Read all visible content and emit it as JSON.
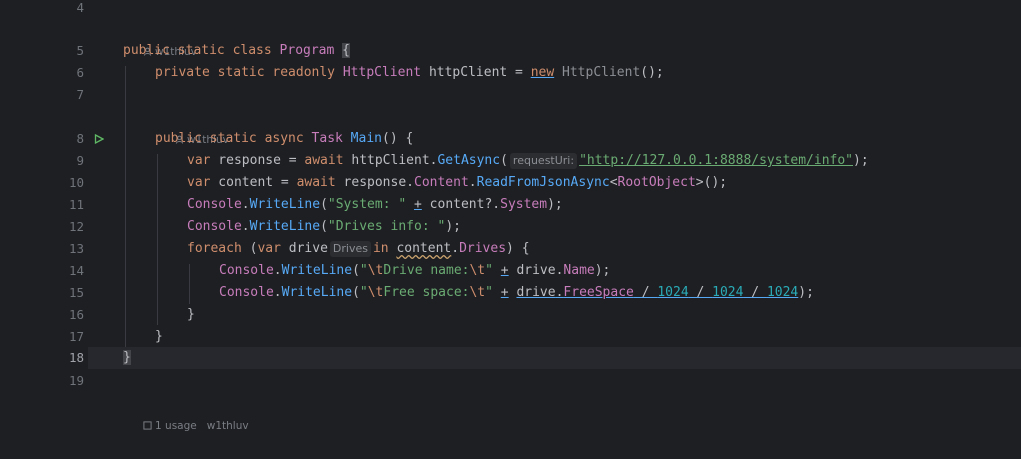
{
  "editor": {
    "lines": [
      {
        "n": "4"
      },
      {
        "n": "5"
      },
      {
        "n": "6"
      },
      {
        "n": "7"
      },
      {
        "n": "8"
      },
      {
        "n": "9"
      },
      {
        "n": "10"
      },
      {
        "n": "11"
      },
      {
        "n": "12"
      },
      {
        "n": "13"
      },
      {
        "n": "14"
      },
      {
        "n": "15"
      },
      {
        "n": "16"
      },
      {
        "n": "17"
      },
      {
        "n": "18"
      },
      {
        "n": "19"
      }
    ],
    "author_hint_1": "w1thluv",
    "author_hint_2": "w1thluv",
    "bottom_hint": "1 usage   w1thluv",
    "param_hint_request_uri": "requestUri:",
    "type_hint_drives": "Drives",
    "code": {
      "l5_kw": "public static class ",
      "l5_cls": "Program",
      "l5_brace": "{",
      "l6_kw": "private static readonly ",
      "l6_type": "HttpClient",
      "l6_rest": " httpClient = ",
      "l6_new": "new",
      "l6_ctor": " HttpClient",
      "l6_end": "();",
      "l8_kw": "public static async ",
      "l8_type": "Task",
      "l8_main": " Main",
      "l8_end": "() {",
      "l9_var": "var",
      "l9_a": " response = ",
      "l9_await": "await",
      "l9_b": " httpClient.",
      "l9_get": "GetAsync",
      "l9_open": "(",
      "l9_url": "\"http://127.0.0.1:8888/system/info\"",
      "l9_end": ");",
      "l10_var": "var",
      "l10_a": " content = ",
      "l10_await": "await",
      "l10_b": " response.",
      "l10_content": "Content",
      "l10_dot": ".",
      "l10_read": "ReadFromJsonAsync",
      "l10_lt": "<",
      "l10_root": "RootObject",
      "l10_end": ">();",
      "l11_console": "Console",
      "l11_dot": ".",
      "l11_wl": "WriteLine",
      "l11_open": "(",
      "l11_str": "\"System: \"",
      "l11_plus": "+",
      "l11_b": " content?.",
      "l11_sys": "System",
      "l11_end": ");",
      "l12_console": "Console",
      "l12_dot": ".",
      "l12_wl": "WriteLine",
      "l12_open": "(",
      "l12_str": "\"Drives info: \"",
      "l12_end": ");",
      "l13_foreach": "foreach",
      "l13_open": " (",
      "l13_var": "var",
      "l13_drive": " drive",
      "l13_in": "in",
      "l13_content": "content",
      "l13_dot": ".",
      "l13_drives": "Drives",
      "l13_end": ") {",
      "l14_console": "Console",
      "l14_dot": ".",
      "l14_wl": "WriteLine",
      "l14_open": "(",
      "l14_q1": "\"",
      "l14_esc1": "\\t",
      "l14_txt": "Drive name:",
      "l14_esc2": "\\t",
      "l14_q2": "\"",
      "l14_plus": "+",
      "l14_b": " drive.",
      "l14_name": "Name",
      "l14_end": ");",
      "l15_console": "Console",
      "l15_dot": ".",
      "l15_wl": "WriteLine",
      "l15_open": "(",
      "l15_q1": "\"",
      "l15_esc1": "\\t",
      "l15_txt": "Free space:",
      "l15_esc2": "\\t",
      "l15_q2": "\"",
      "l15_plus": "+",
      "l15_drive": "drive",
      "l15_fs": "FreeSpace",
      "l15_div1": " / ",
      "l15_n1": "1024",
      "l15_div2": " / ",
      "l15_n2": "1024",
      "l15_div3": " / ",
      "l15_n3": "1024",
      "l15_close": ")",
      "l15_semi": ";",
      "l16": "}",
      "l17": "}",
      "l18": "}"
    }
  }
}
